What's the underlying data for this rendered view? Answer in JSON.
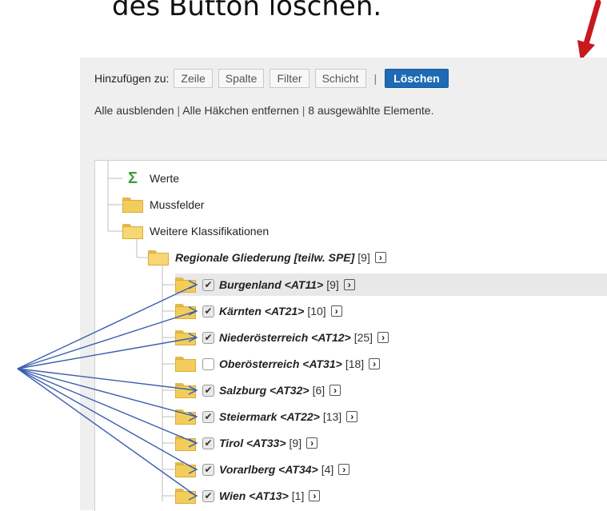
{
  "heading": "des Button löschen.",
  "colors": {
    "delete_button": "#1e6ab4",
    "annotation_red": "#c8191e",
    "annotation_blue": "#3b5fae",
    "folder": "#f3cd5c",
    "sigma": "#3aa03a"
  },
  "toolbar": {
    "add_to_label": "Hinzufügen zu:",
    "buttons": [
      "Zeile",
      "Spalte",
      "Filter",
      "Schicht"
    ],
    "separator": "|",
    "delete_label": "Löschen"
  },
  "links": {
    "hide_all": "Alle ausblenden",
    "remove_checks": "Alle Häkchen entfernen",
    "selected_count": "8 ausgewählte Elemente.",
    "pipe": "|"
  },
  "tree": {
    "nodes": [
      {
        "label": "Werte",
        "icon": "sigma-icon"
      },
      {
        "label": "Mussfelder",
        "icon": "folder-icon"
      },
      {
        "label": "Weitere Klassifikationen",
        "icon": "folder-open-icon"
      }
    ],
    "group": {
      "label": "Regionale Gliederung [teilw. SPE]",
      "count": "[9]",
      "expand": "›"
    },
    "regions": [
      {
        "label": "Burgenland <AT11>",
        "count": "[9]",
        "checked": true,
        "expand": "›"
      },
      {
        "label": "Kärnten <AT21>",
        "count": "[10]",
        "checked": true,
        "expand": "›"
      },
      {
        "label": "Niederösterreich <AT12>",
        "count": "[25]",
        "checked": true,
        "expand": "›"
      },
      {
        "label": "Oberösterreich <AT31>",
        "count": "[18]",
        "checked": false,
        "expand": "›"
      },
      {
        "label": "Salzburg <AT32>",
        "count": "[6]",
        "checked": true,
        "expand": "›"
      },
      {
        "label": "Steiermark <AT22>",
        "count": "[13]",
        "checked": true,
        "expand": "›"
      },
      {
        "label": "Tirol <AT33>",
        "count": "[9]",
        "checked": true,
        "expand": "›"
      },
      {
        "label": "Vorarlberg <AT34>",
        "count": "[4]",
        "checked": true,
        "expand": "›"
      },
      {
        "label": "Wien <AT13>",
        "count": "[1]",
        "checked": true,
        "expand": "›"
      }
    ],
    "check_glyph": "✔"
  }
}
